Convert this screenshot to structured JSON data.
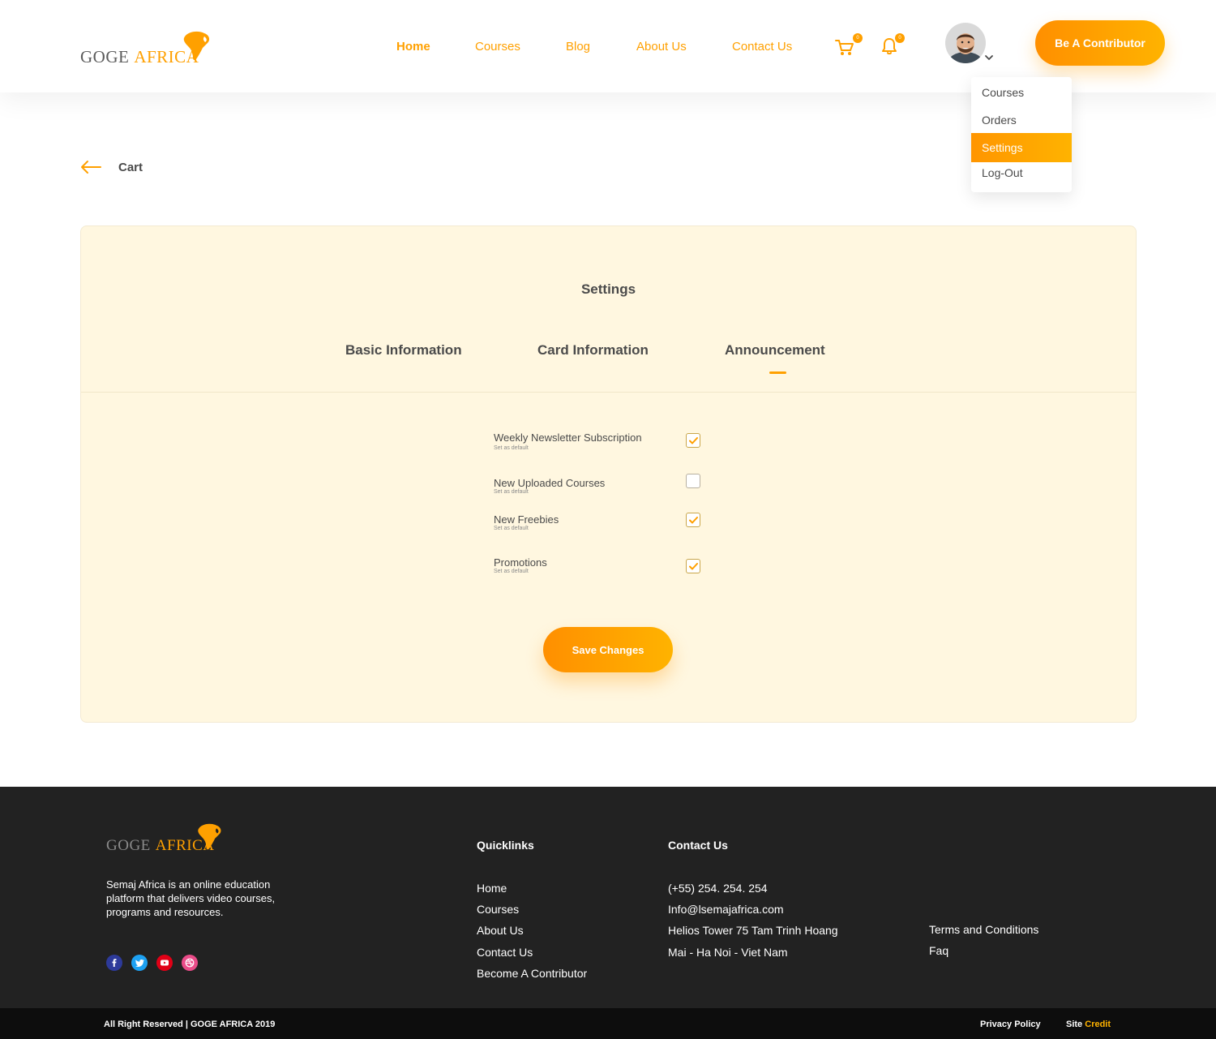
{
  "colors": {
    "accent": "#ffa000",
    "card_bg": "#fff7e0",
    "footer_bg": "#222222",
    "bottom_bg": "#0d0d0d"
  },
  "header": {
    "logo": {
      "word1": "GOGE",
      "word2": "AFRICA"
    },
    "nav": [
      {
        "label": "Home",
        "active": true
      },
      {
        "label": "Courses",
        "active": false
      },
      {
        "label": "Blog",
        "active": false
      },
      {
        "label": "About Us",
        "active": false
      },
      {
        "label": "Contact Us",
        "active": false
      }
    ],
    "cart_badge": "0",
    "notification_badge": "0",
    "icons": [
      "cart-icon",
      "bell-icon",
      "avatar",
      "chevron-down-icon"
    ],
    "cta_label": "Be A Contributor"
  },
  "user_menu": {
    "items": [
      {
        "label": "Courses",
        "active": false
      },
      {
        "label": "Orders",
        "active": false
      },
      {
        "label": "Settings",
        "active": true
      },
      {
        "label": "Log-Out",
        "active": false
      }
    ]
  },
  "back_link": {
    "label": "Cart",
    "icon": "arrow-left-icon"
  },
  "settings": {
    "title": "Settings",
    "tabs": [
      {
        "label": "Basic Information",
        "active": false
      },
      {
        "label": "Card Information",
        "active": false
      },
      {
        "label": "Announcement",
        "active": true
      }
    ],
    "options": [
      {
        "label": "Weekly Newsletter Subscription",
        "sub": "Set as default",
        "checked": true
      },
      {
        "label": "New Uploaded Courses",
        "sub": "Set as default",
        "checked": false
      },
      {
        "label": "New Freebies",
        "sub": "Set as default",
        "checked": true
      },
      {
        "label": "Promotions",
        "sub": "Set as default",
        "checked": true
      }
    ],
    "save_label": "Save Changes"
  },
  "footer": {
    "logo": {
      "word1": "GOGE",
      "word2": "AFRICA"
    },
    "description": "Semaj Africa is an online education platform that delivers video courses, programs and resources.",
    "social": [
      "facebook-icon",
      "twitter-icon",
      "youtube-icon",
      "dribbble-icon"
    ],
    "quicklinks_title": "Quicklinks",
    "quicklinks": [
      "Home",
      "Courses",
      "About Us",
      "Contact Us",
      "Become A Contributor"
    ],
    "contact_title": "Contact Us",
    "contact": [
      "(+55) 254. 254. 254",
      "Info@lsemajafrica.com",
      "Helios Tower 75 Tam Trinh Hoang",
      "Mai - Ha Noi - Viet Nam"
    ],
    "extra_links": [
      "Terms and Conditions",
      "Faq"
    ]
  },
  "bottom_bar": {
    "copyright": "All Right Reserved | GOGE AFRICA 2019",
    "privacy": "Privacy Policy",
    "site_label": "Site",
    "credit_label": "Credit"
  }
}
